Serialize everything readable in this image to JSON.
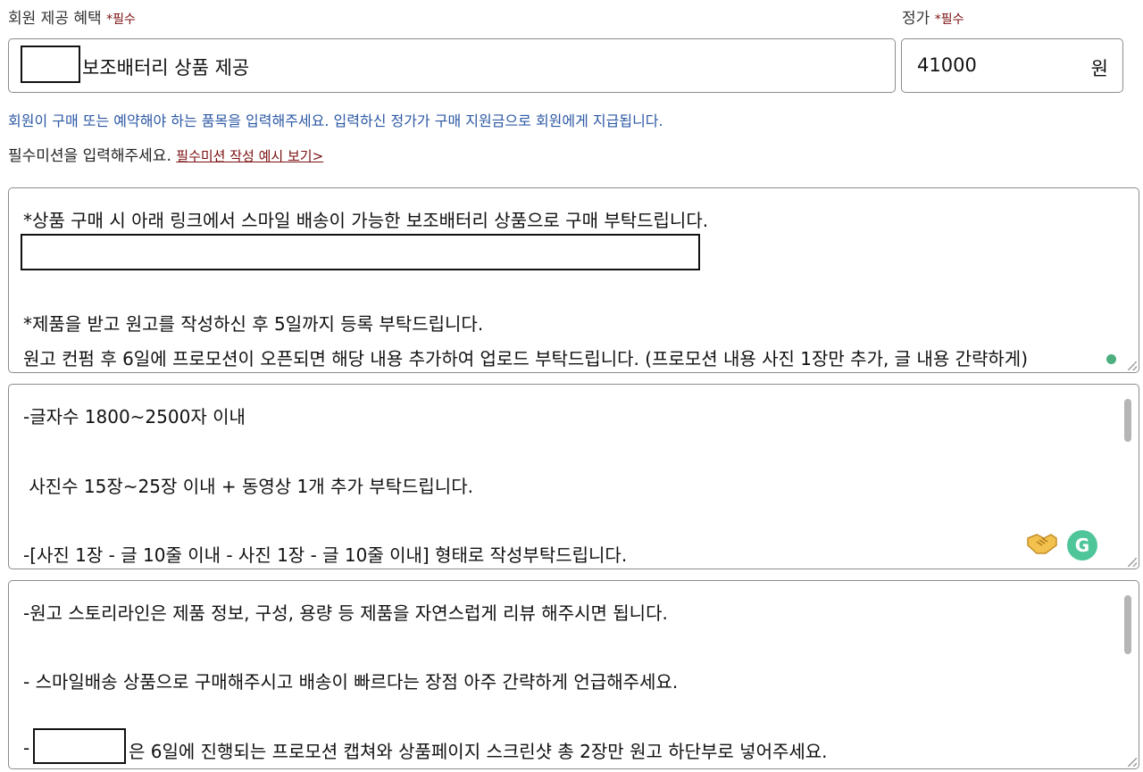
{
  "benefit": {
    "label": "회원 제공 혜택",
    "required": "*필수",
    "value": "보조배터리 상품 제공"
  },
  "price": {
    "label": "정가",
    "required": "*필수",
    "value": "41000",
    "unit": "원"
  },
  "help_text": "회원이 구매 또는 예약해야 하는 품목을 입력해주세요. 입력하신 정가가 구매 지원금으로 회원에게 지급됩니다.",
  "mission": {
    "prompt": "필수미션을 입력해주세요.",
    "example_link": "필수미션 작성 예시 보기>"
  },
  "mission_box_1": {
    "lines": [
      "*상품 구매 시 아래 링크에서 스마일 배송이 가능한 보조배터리 상품으로 구매 부탁드립니다.",
      "*제품을 받고 원고를 작성하신 후 5일까지 등록 부탁드립니다.",
      "원고 컨펌 후 6일에 프로모션이 오픈되면 해당 내용 추가하여 업로드 부탁드립니다. (프로모션 내용 사진 1장만 추가, 글 내용 간략하게)"
    ]
  },
  "mission_box_2": {
    "lines": [
      "-글자수 1800~2500자 이내",
      " 사진수 15장~25장 이내 + 동영상 1개 추가 부탁드립니다.",
      "-[사진 1장 - 글 10줄 이내 - 사진 1장 - 글 10줄 이내] 형태로 작성부탁드립니다."
    ],
    "grammarly_glyph": "G",
    "icons": [
      "handshake-icon",
      "grammarly-icon"
    ]
  },
  "mission_box_3": {
    "lines": [
      "-원고 스토리라인은 제품 정보, 구성, 용량 등 제품을 자연스럽게 리뷰 해주시면 됩니다.",
      "- 스마일배송 상품으로 구매해주시고 배송이 빠르다는 장점 아주 간략하게 언급해주세요.",
      "-",
      "은 6일에 진행되는 프로모션 캡쳐와 상품페이지 스크린샷 총 2장만 원고 하단부로 넣어주세요."
    ]
  },
  "colors": {
    "required": "#7a0f10",
    "help": "#2c58a4",
    "grammarly": "#4fc59a"
  }
}
